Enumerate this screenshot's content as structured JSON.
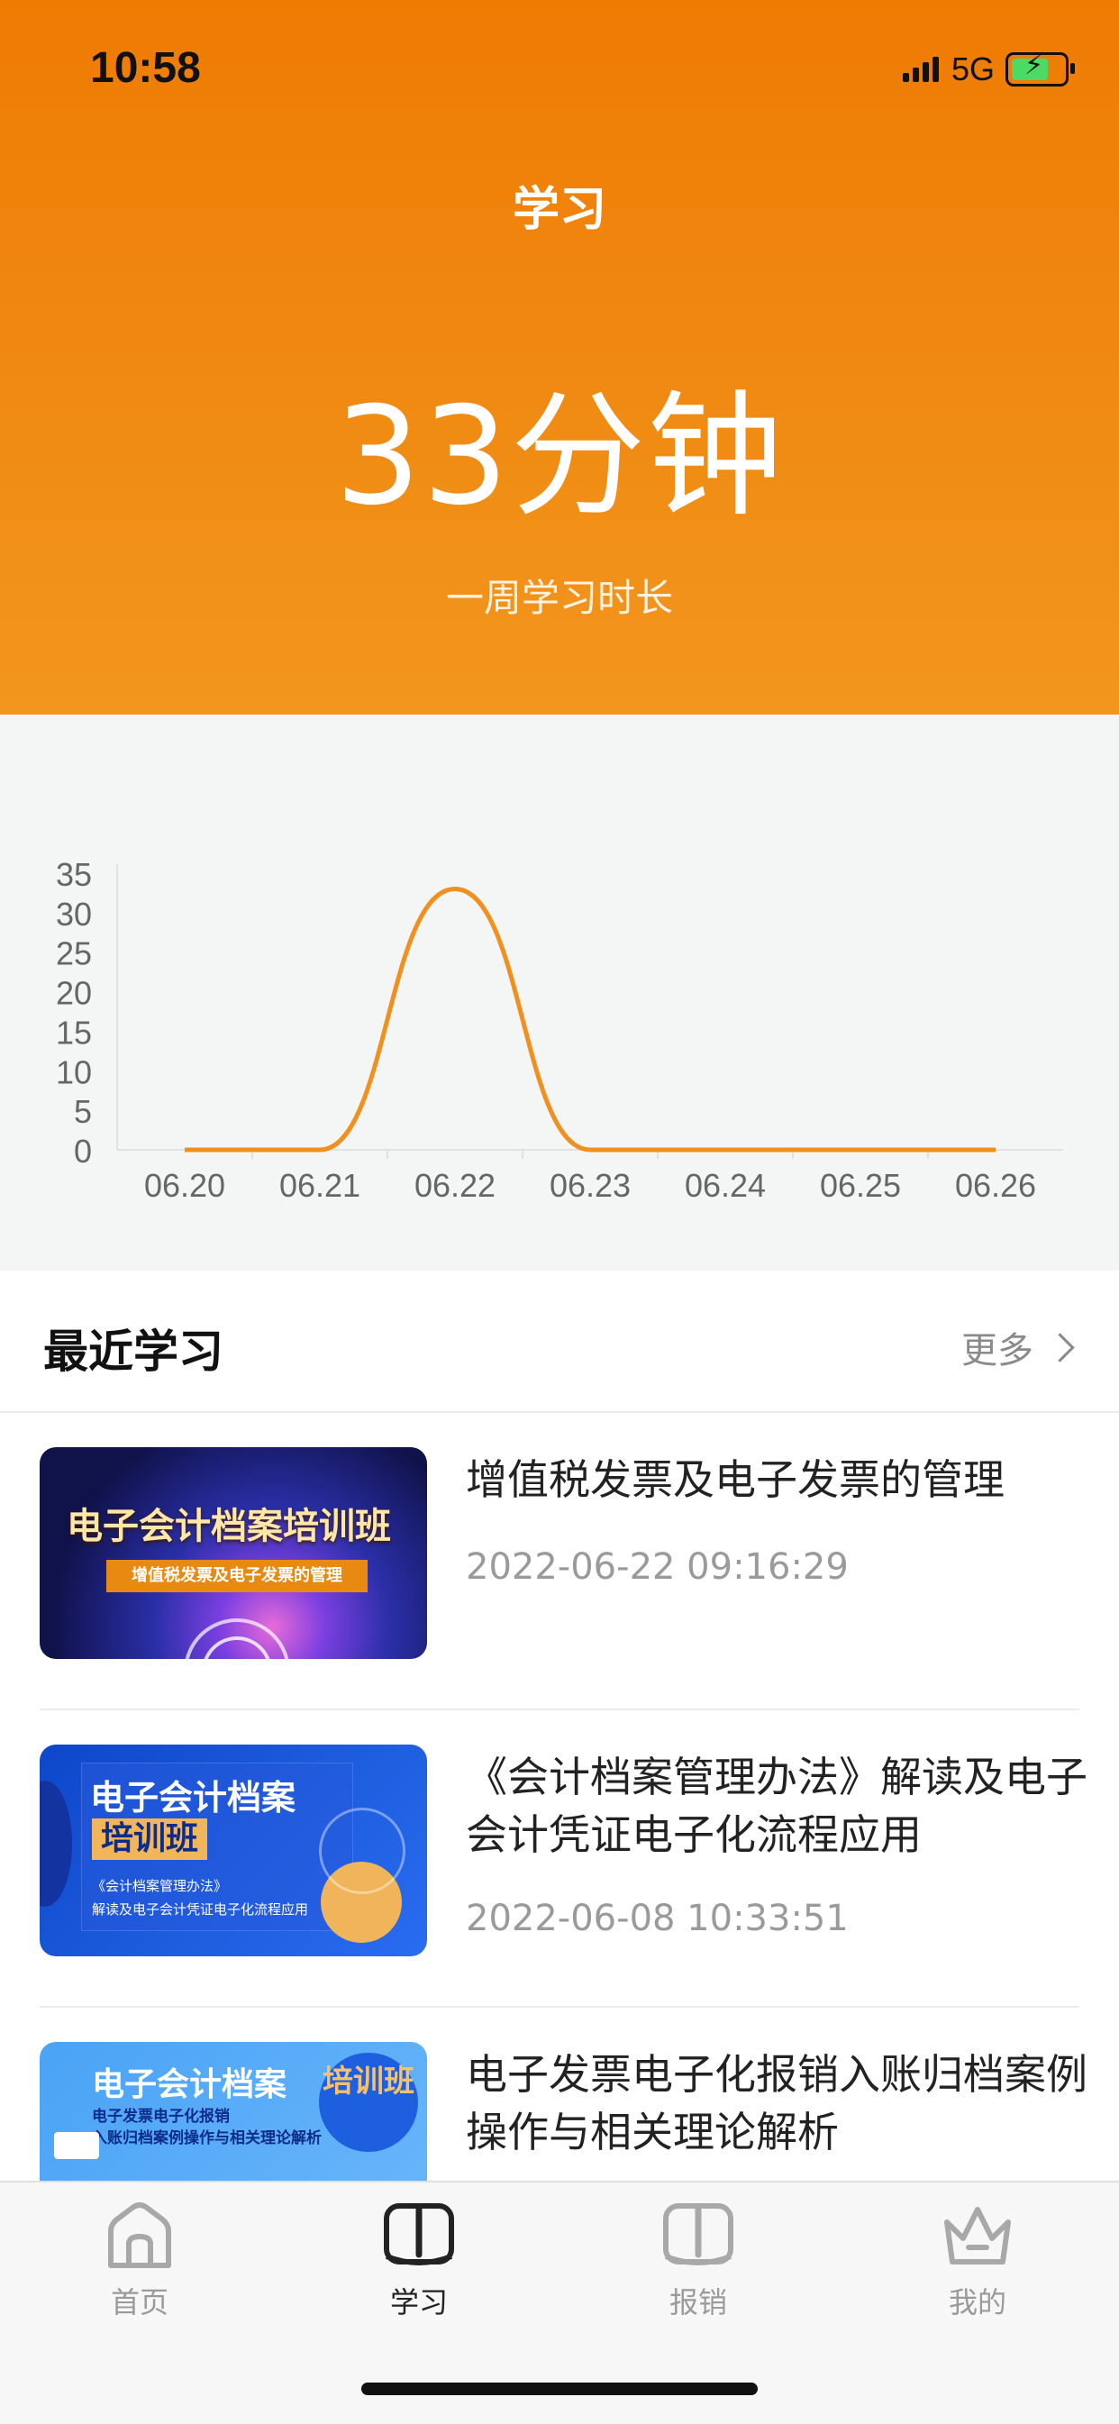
{
  "status_bar": {
    "time": "10:58",
    "network": "5G"
  },
  "header": {
    "title": "学习",
    "total_value": "33分钟",
    "caption": "一周学习时长"
  },
  "chart_data": {
    "type": "line",
    "categories": [
      "06.20",
      "06.21",
      "06.22",
      "06.23",
      "06.24",
      "06.25",
      "06.26"
    ],
    "series": [
      {
        "values": [
          0,
          0,
          33,
          0,
          0,
          0,
          0
        ]
      }
    ],
    "ylim": [
      0,
      35
    ],
    "yticks": [
      0,
      5,
      10,
      15,
      20,
      25,
      30,
      35
    ],
    "smooth": true,
    "grid": false,
    "color": "#f0901e"
  },
  "recent": {
    "title": "最近学习",
    "more_label": "更多",
    "items": [
      {
        "title": "增值税发票及电子发票的管理",
        "date": "2022-06-22 09:16:29",
        "thumb_title": "电子会计档案培训班",
        "thumb_subtitle": "增值税发票及电子发票的管理"
      },
      {
        "title": "《会计档案管理办法》解读及电子会计凭证电子化流程应用",
        "date": "2022-06-08 10:33:51",
        "thumb_title": "电子会计档案",
        "thumb_badge": "培训班",
        "thumb_subtitle": "《会计档案管理办法》",
        "thumb_subtitle2": "解读及电子会计凭证电子化流程应用"
      },
      {
        "title": "电子发票电子化报销入账归档案例操作与相关理论解析",
        "thumb_title": "电子会计档案",
        "thumb_badge": "培训班",
        "thumb_subtitle": "电子发票电子化报销",
        "thumb_subtitle2": "入账归档案例操作与相关理论解析"
      }
    ]
  },
  "tabs": [
    {
      "label": "首页",
      "icon": "home-icon",
      "active": false
    },
    {
      "label": "学习",
      "icon": "book-icon",
      "active": true
    },
    {
      "label": "报销",
      "icon": "book-icon",
      "active": false
    },
    {
      "label": "我的",
      "icon": "crown-icon",
      "active": false
    }
  ]
}
